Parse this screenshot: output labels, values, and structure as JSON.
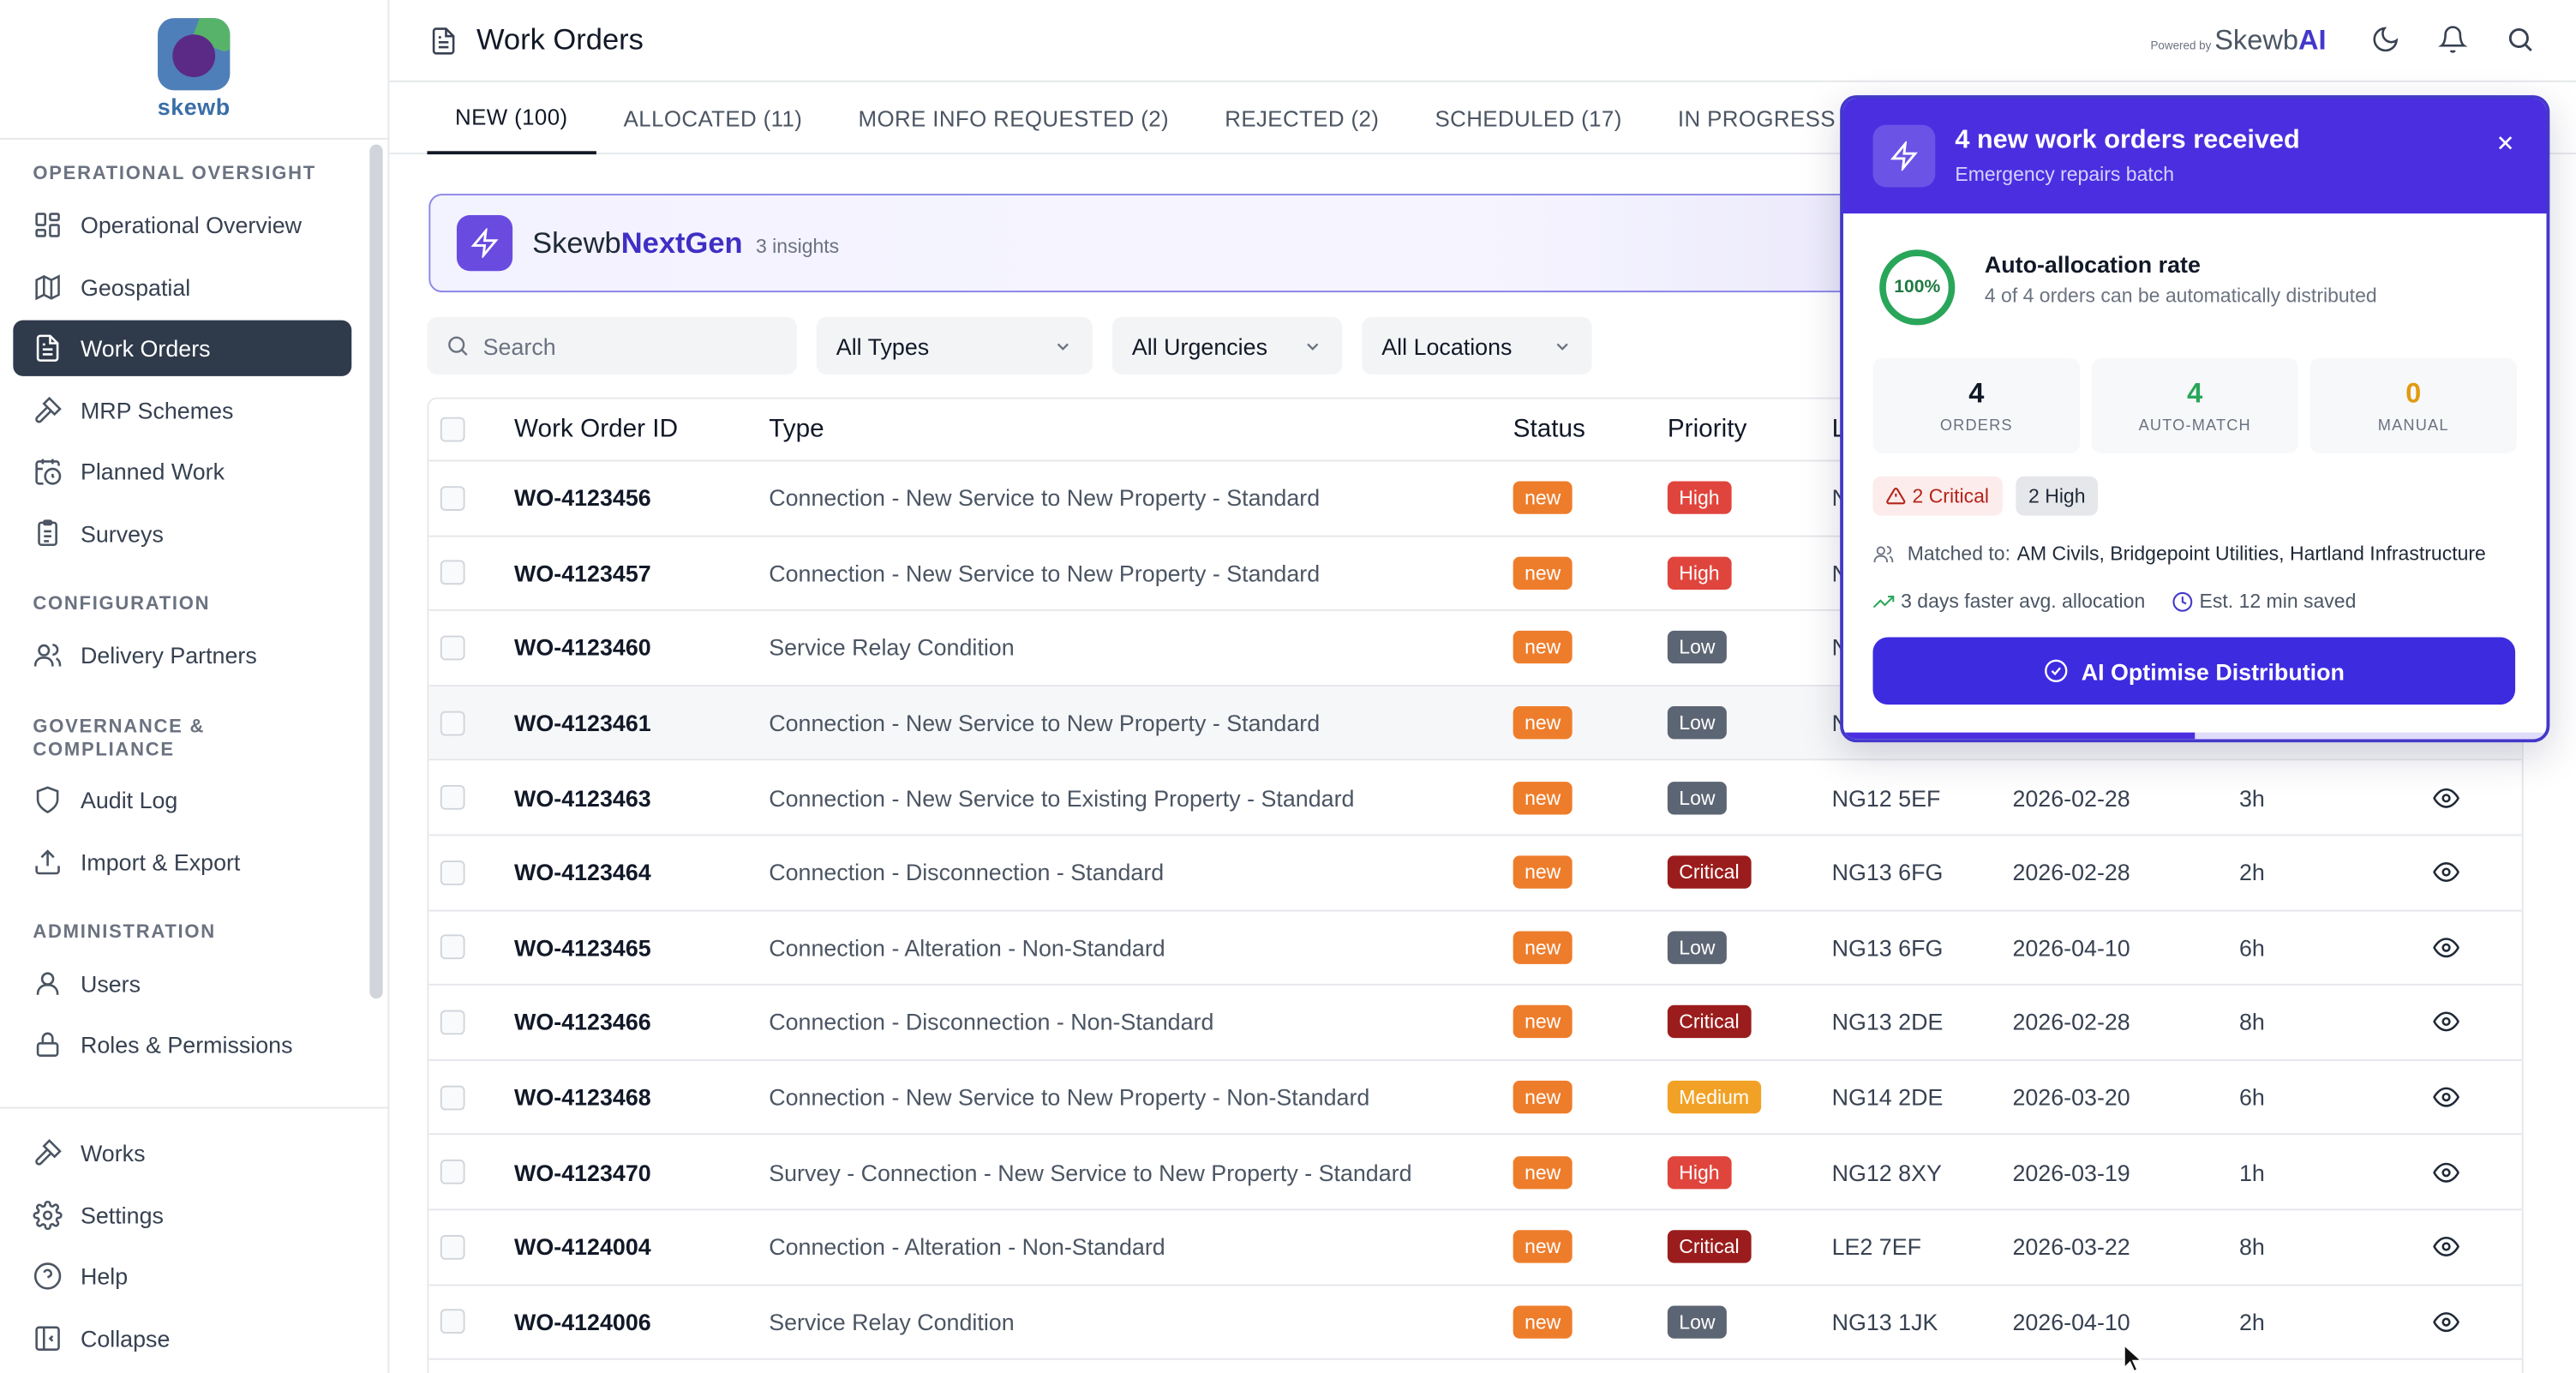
{
  "header": {
    "title": "Work Orders",
    "powered_by": "Powered by",
    "brand_prefix": "Skewb",
    "brand_suffix": "AI"
  },
  "sidebar": {
    "logo_text": "skewb",
    "sections": {
      "oversight": "OPERATIONAL OVERSIGHT",
      "configuration": "CONFIGURATION",
      "governance": "GOVERNANCE & COMPLIANCE",
      "administration": "ADMINISTRATION"
    },
    "items": {
      "overview": "Operational Overview",
      "geospatial": "Geospatial",
      "work_orders": "Work Orders",
      "mrp": "MRP Schemes",
      "planned": "Planned Work",
      "surveys": "Surveys",
      "delivery": "Delivery Partners",
      "audit": "Audit Log",
      "import": "Import & Export",
      "users": "Users",
      "roles": "Roles & Permissions"
    },
    "bottom": {
      "works": "Works",
      "settings": "Settings",
      "help": "Help",
      "collapse": "Collapse"
    }
  },
  "tabs": [
    {
      "label": "NEW (100)"
    },
    {
      "label": "ALLOCATED (11)"
    },
    {
      "label": "MORE INFO REQUESTED (2)"
    },
    {
      "label": "REJECTED (2)"
    },
    {
      "label": "SCHEDULED (17)"
    },
    {
      "label": "IN PROGRESS (5)"
    }
  ],
  "banner": {
    "name_prefix": "Skewb",
    "name_bold": "NextGen",
    "insights": "3 insights"
  },
  "filters": {
    "search_placeholder": "Search",
    "types": "All Types",
    "urgencies": "All Urgencies",
    "locations": "All Locations"
  },
  "table": {
    "headers": {
      "id": "Work Order ID",
      "type": "Type",
      "status": "Status",
      "priority": "Priority",
      "location_partial": "L"
    },
    "rows": [
      {
        "id": "WO-4123456",
        "type": "Connection - New Service to New Property - Standard",
        "status": "new",
        "priority": "High",
        "location": "N",
        "date": "",
        "duration": ""
      },
      {
        "id": "WO-4123457",
        "type": "Connection - New Service to New Property - Standard",
        "status": "new",
        "priority": "High",
        "location": "N",
        "date": "",
        "duration": ""
      },
      {
        "id": "WO-4123460",
        "type": "Service Relay Condition",
        "status": "new",
        "priority": "Low",
        "location": "N",
        "date": "",
        "duration": ""
      },
      {
        "id": "WO-4123461",
        "type": "Connection - New Service to New Property - Standard",
        "status": "new",
        "priority": "Low",
        "location": "N",
        "date": "",
        "duration": ""
      },
      {
        "id": "WO-4123463",
        "type": "Connection - New Service to Existing Property - Standard",
        "status": "new",
        "priority": "Low",
        "location": "NG12 5EF",
        "date": "2026-02-28",
        "duration": "3h"
      },
      {
        "id": "WO-4123464",
        "type": "Connection - Disconnection - Standard",
        "status": "new",
        "priority": "Critical",
        "location": "NG13 6FG",
        "date": "2026-02-28",
        "duration": "2h"
      },
      {
        "id": "WO-4123465",
        "type": "Connection - Alteration - Non-Standard",
        "status": "new",
        "priority": "Low",
        "location": "NG13 6FG",
        "date": "2026-04-10",
        "duration": "6h"
      },
      {
        "id": "WO-4123466",
        "type": "Connection - Disconnection - Non-Standard",
        "status": "new",
        "priority": "Critical",
        "location": "NG13 2DE",
        "date": "2026-02-28",
        "duration": "8h"
      },
      {
        "id": "WO-4123468",
        "type": "Connection - New Service to New Property - Non-Standard",
        "status": "new",
        "priority": "Medium",
        "location": "NG14 2DE",
        "date": "2026-03-20",
        "duration": "6h"
      },
      {
        "id": "WO-4123470",
        "type": "Survey - Connection - New Service to New Property - Standard",
        "status": "new",
        "priority": "High",
        "location": "NG12 8XY",
        "date": "2026-03-19",
        "duration": "1h"
      },
      {
        "id": "WO-4124004",
        "type": "Connection - Alteration - Non-Standard",
        "status": "new",
        "priority": "Critical",
        "location": "LE2 7EF",
        "date": "2026-03-22",
        "duration": "8h"
      },
      {
        "id": "WO-4124006",
        "type": "Service Relay Condition",
        "status": "new",
        "priority": "Low",
        "location": "NG13 1JK",
        "date": "2026-04-10",
        "duration": "2h"
      }
    ]
  },
  "popup": {
    "title": "4 new work orders received",
    "subtitle": "Emergency repairs batch",
    "rate_value": "100%",
    "rate_title": "Auto-allocation rate",
    "rate_desc": "4 of 4 orders can be automatically distributed",
    "stats": [
      {
        "value": "4",
        "label": "ORDERS",
        "color": "#111827"
      },
      {
        "value": "4",
        "label": "AUTO-MATCH",
        "color": "#2aa65a"
      },
      {
        "value": "0",
        "label": "MANUAL",
        "color": "#e29a12"
      }
    ],
    "chip_critical": "2 Critical",
    "chip_high": "2 High",
    "matched_label": "Matched to:",
    "matched_value": "AM Civils, Bridgepoint Utilities, Hartland Infrastructure",
    "faster": "3 days faster avg. allocation",
    "saved": "Est. 12 min saved",
    "button": "AI Optimise Distribution",
    "progress": 0.5
  }
}
